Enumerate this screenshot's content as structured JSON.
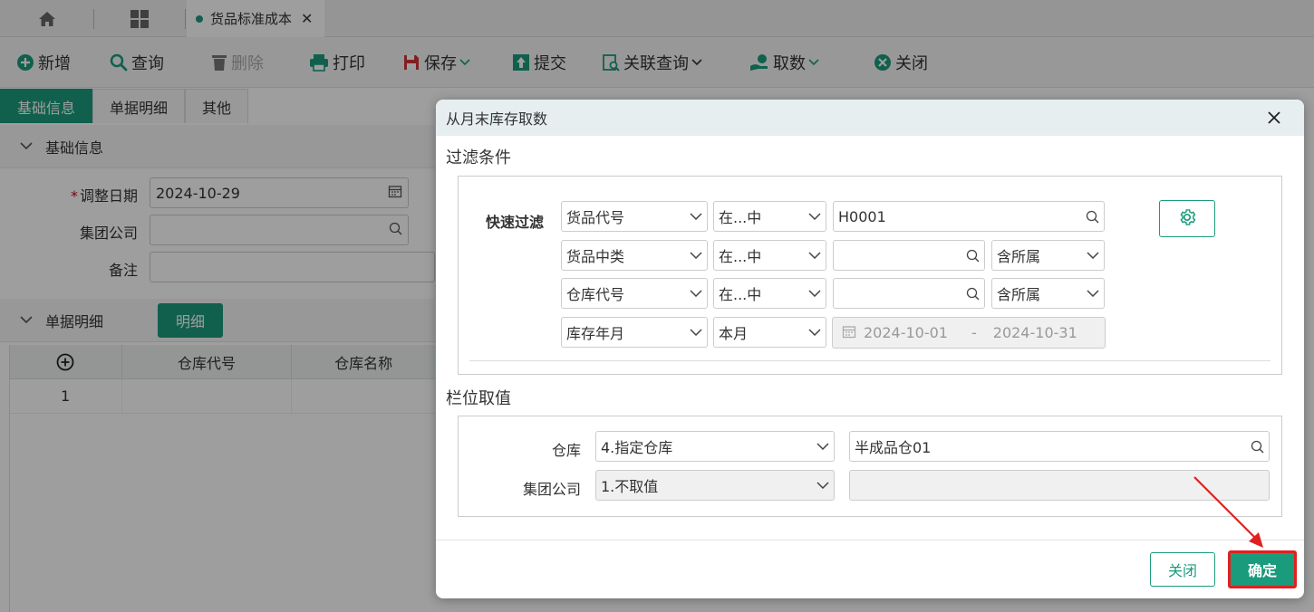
{
  "topbar": {
    "tab_label": "货品标准成本"
  },
  "toolbar": {
    "add": "新增",
    "query": "查询",
    "delete": "删除",
    "print": "打印",
    "save": "保存",
    "submit": "提交",
    "related_query": "关联查询",
    "fetch": "取数",
    "close": "关闭"
  },
  "form_tabs": [
    "基础信息",
    "单据明细",
    "其他"
  ],
  "basic": {
    "section_title": "基础信息",
    "adjust_date_label": "调整日期",
    "adjust_date_value": "2024-10-29",
    "company_label": "集团公司",
    "remark_label": "备注"
  },
  "detail": {
    "section_title": "单据明细",
    "detail_button": "明细",
    "columns": [
      "仓库代号",
      "仓库名称"
    ],
    "rows": [
      {
        "index": "1"
      }
    ]
  },
  "dialog": {
    "title": "从月末库存取数",
    "filter_title": "过滤条件",
    "quick_filter_label": "快速过滤",
    "filters": [
      {
        "field": "货品代号",
        "op": "在...中",
        "value": "H0001",
        "extra": ""
      },
      {
        "field": "货品中类",
        "op": "在...中",
        "value": "",
        "extra": "含所属"
      },
      {
        "field": "仓库代号",
        "op": "在...中",
        "value": "",
        "extra": "含所属"
      },
      {
        "field": "库存年月",
        "op": "本月",
        "date_from": "2024-10-01",
        "date_sep": "-",
        "date_to": "2024-10-31"
      }
    ],
    "field_value_title": "栏位取值",
    "field_values": [
      {
        "label": "仓库",
        "mode": "4.指定仓库",
        "value": "半成品仓01"
      },
      {
        "label": "集团公司",
        "mode": "1.不取值",
        "value": ""
      }
    ],
    "close_button": "关闭",
    "ok_button": "确定"
  },
  "colors": {
    "accent": "#1a9b7c",
    "highlight": "#e02020"
  }
}
